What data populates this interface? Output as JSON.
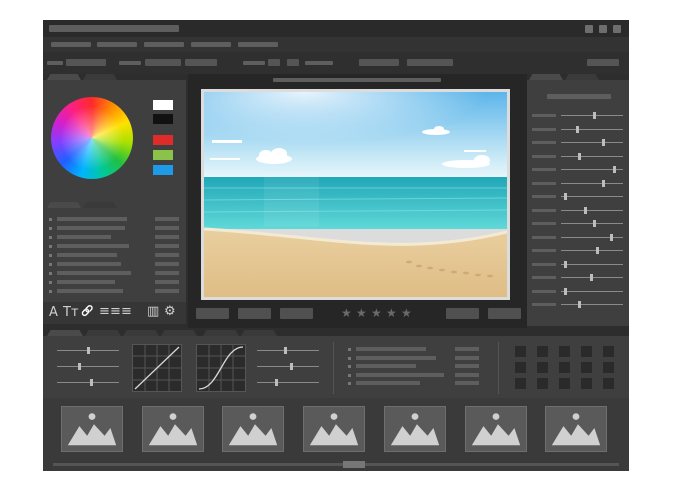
{
  "canvas": {
    "background": "#ffffff"
  },
  "colors": {
    "window_bg": "#2d2d2d",
    "panel_bg": "#3f3f3f",
    "placeholder_bar": "#5e5e5e",
    "image_frame": "#dcdcdc",
    "sky_top": "#74c4ee",
    "sea": "#2bb8c0",
    "sand": "#e5c795"
  },
  "swatches": [
    "#ffffff",
    "#111111",
    "#e02b2b",
    "#8bc34a",
    "#1e9be8"
  ],
  "toolbar_icons": [
    "text-icon",
    "text-size-icon",
    "link-icon",
    "align-icon",
    "align-icon",
    "align-icon",
    "trash-icon",
    "gear-icon"
  ],
  "toolbar_glyphs": {
    "text": "A",
    "text_size": "Tт",
    "link": "🔗",
    "align": "≡",
    "trash": "▥",
    "gear": "⚙"
  },
  "rating": {
    "max": 5,
    "value": 0,
    "glyph": "★"
  },
  "thumbnails_count": 7
}
